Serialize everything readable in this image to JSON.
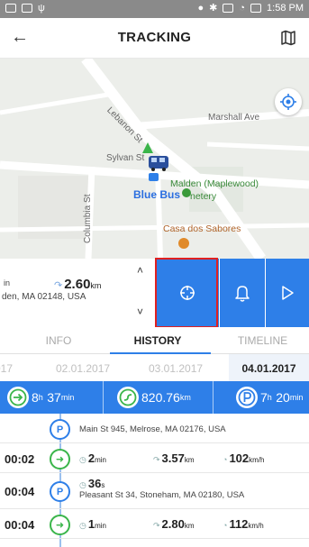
{
  "status_bar": {
    "time": "1:58 PM"
  },
  "app_bar": {
    "title": "TRACKING",
    "back_glyph": "←",
    "map_icon": "map-icon"
  },
  "map": {
    "streets": [
      "Lebanon St",
      "Marshall Ave",
      "Sylvan St",
      "Columbia St"
    ],
    "places": {
      "vehicle": "Blue Bus",
      "poi1": "Malden (Maplewood)",
      "poi1_suffix": "netery",
      "poi2": "Casa dos Sabores"
    }
  },
  "info_strip": {
    "distance_value": "2.60",
    "distance_unit": "km",
    "left_fragment": "in",
    "address": "den, MA 02148, USA"
  },
  "actions": {
    "center": "crosshair-icon",
    "alert": "bell-icon",
    "play": "play-icon"
  },
  "tabs": {
    "info": "INFO",
    "history": "HISTORY",
    "timeline": "TIMELINE"
  },
  "dates": [
    "017",
    "02.01.2017",
    "03.01.2017",
    "04.01.2017"
  ],
  "summary": {
    "driving": {
      "h": "8",
      "h_unit": "h",
      "m": "37",
      "m_unit": "min"
    },
    "distance": {
      "value": "820.76",
      "unit": "km"
    },
    "parking": {
      "h": "7",
      "h_unit": "h",
      "m": "20",
      "m_unit": "min"
    }
  },
  "history": [
    {
      "type": "parking",
      "time": "",
      "address": "Main St 945, Melrose, MA 02176, USA"
    },
    {
      "type": "trip",
      "time": "00:02",
      "duration": "2",
      "duration_unit": "min",
      "distance": "3.57",
      "distance_unit": "km",
      "speed": "102",
      "speed_unit": "km/h"
    },
    {
      "type": "parking",
      "time": "00:04",
      "duration": "36",
      "duration_unit": "s",
      "address": "Pleasant St 34, Stoneham, MA 02180, USA"
    },
    {
      "type": "trip",
      "time": "00:04",
      "duration": "1",
      "duration_unit": "min",
      "distance": "2.80",
      "distance_unit": "km",
      "speed": "112",
      "speed_unit": "km/h"
    }
  ],
  "colors": {
    "accent": "#2e7fe8",
    "highlight": "#e02020",
    "trip": "#3ab54a"
  }
}
